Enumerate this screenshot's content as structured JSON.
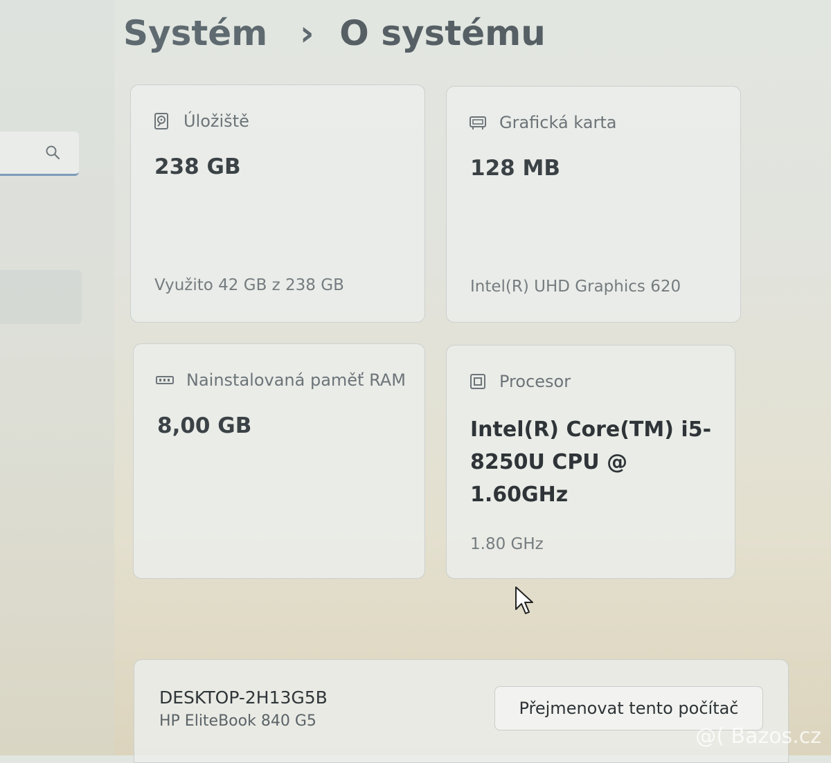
{
  "header": {
    "breadcrumb_parent": "Systém",
    "breadcrumb_separator": "›",
    "breadcrumb_current": "O systému"
  },
  "sidebar": {
    "search_icon": "search-icon"
  },
  "cards": {
    "storage": {
      "icon": "hard-drive-icon",
      "label": "Úložiště",
      "value": "238 GB",
      "detail": "Využito 42 GB z 238 GB"
    },
    "gpu": {
      "icon": "graphics-card-icon",
      "label": "Grafická karta",
      "value": "128 MB",
      "detail": "Intel(R) UHD Graphics 620"
    },
    "ram": {
      "icon": "memory-icon",
      "label": "Nainstalovaná paměť RAM",
      "value": "8,00 GB"
    },
    "cpu": {
      "icon": "processor-icon",
      "label": "Procesor",
      "value": "Intel(R) Core(TM) i5-8250U CPU @ 1.60GHz",
      "detail": "1.80 GHz"
    }
  },
  "device": {
    "name": "DESKTOP-2H13G5B",
    "model": "HP EliteBook 840 G5",
    "rename_label": "Přejmenovat tento počítač"
  },
  "watermark": "@( Bazos.cz",
  "colors": {
    "accent_underline": "#7d9bb8",
    "card_background": "#eceeec",
    "heading_text": "#5e6a70"
  }
}
